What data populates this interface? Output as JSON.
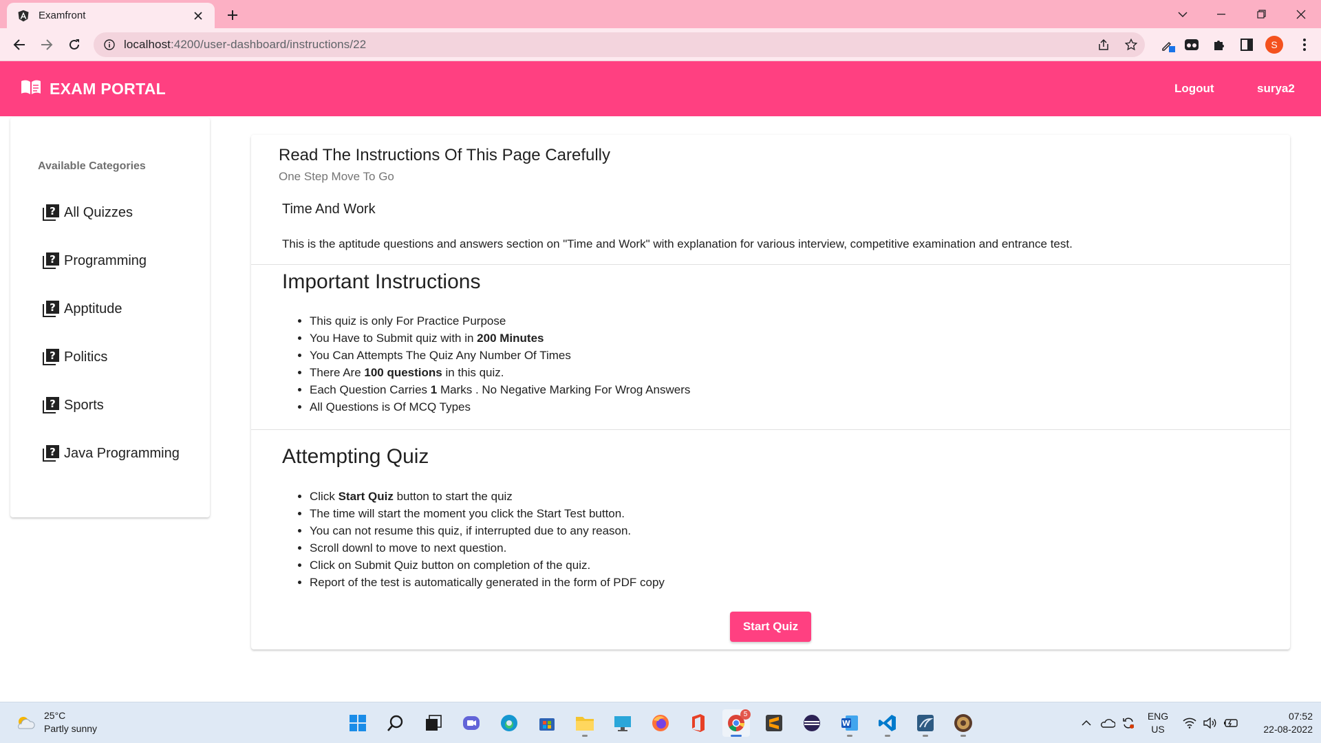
{
  "browser": {
    "tab_title": "Examfront",
    "url_host": "localhost",
    "url_rest": ":4200/user-dashboard/instructions/22",
    "profile_initial": "S"
  },
  "header": {
    "brand": "EXAM PORTAL",
    "logout": "Logout",
    "username": "surya2"
  },
  "sidebar": {
    "heading": "Available Categories",
    "items": [
      {
        "label": "All Quizzes"
      },
      {
        "label": "Programming"
      },
      {
        "label": "Apptitude"
      },
      {
        "label": "Politics"
      },
      {
        "label": "Sports"
      },
      {
        "label": "Java Programming"
      }
    ]
  },
  "main": {
    "title": "Read The Instructions Of This Page Carefully",
    "subtitle": "One Step Move To Go",
    "quiz_title": "Time And Work",
    "quiz_description": "This is the aptitude questions and answers section on \"Time and Work\" with explanation for various interview, competitive examination and entrance test.",
    "important": {
      "heading": "Important Instructions",
      "items": {
        "practice": "This quiz is only For Practice Purpose",
        "time_prefix": "You Have to Submit quiz with in ",
        "time_bold": "200 Minutes",
        "attempts": "You Can Attempts The Quiz Any Number Of Times",
        "count_prefix": "There Are ",
        "count_bold": "100 questions",
        "count_suffix": " in this quiz.",
        "marks_prefix": "Each Question Carries ",
        "marks_bold": "1",
        "marks_suffix": " Marks . No Negative Marking For Wrog Answers",
        "mcq": "All Questions is Of MCQ Types"
      }
    },
    "attempting": {
      "heading": "Attempting Quiz",
      "items": {
        "click_prefix": "Click ",
        "click_bold": "Start Quiz",
        "click_suffix": " button to start the quiz",
        "timer": "The time will start the moment you click the Start Test button.",
        "resume": "You can not resume this quiz, if interrupted due to any reason.",
        "scroll": "Scroll downl to move to next question.",
        "submit": "Click on Submit Quiz button on completion of the quiz.",
        "report": "Report of the test is automatically generated in the form of PDF copy"
      }
    },
    "start_button": "Start Quiz"
  },
  "taskbar": {
    "weather_temp": "25°C",
    "weather_desc": "Partly sunny",
    "chrome_badge": "5",
    "lang_line1": "ENG",
    "lang_line2": "US",
    "time": "07:52",
    "date": "22-08-2022"
  },
  "colors": {
    "accent": "#ff4081",
    "tabstrip": "#fcb0c4",
    "toolbar": "#fde9ef"
  }
}
